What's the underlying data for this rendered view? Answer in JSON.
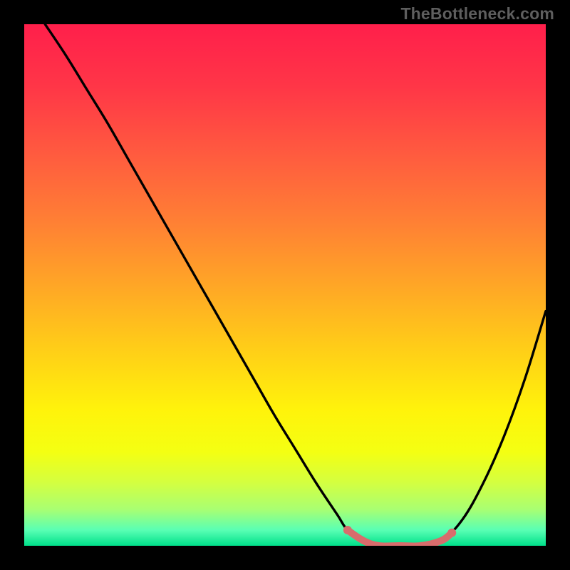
{
  "watermark": "TheBottleneck.com",
  "chart_data": {
    "type": "line",
    "title": "",
    "xlabel": "",
    "ylabel": "",
    "xlim": [
      0,
      100
    ],
    "ylim": [
      0,
      100
    ],
    "grid": false,
    "legend": false,
    "gradient_stops": [
      {
        "offset": 0.0,
        "color": "#ff1f4b"
      },
      {
        "offset": 0.12,
        "color": "#ff3647"
      },
      {
        "offset": 0.25,
        "color": "#ff5b3f"
      },
      {
        "offset": 0.38,
        "color": "#ff8034"
      },
      {
        "offset": 0.5,
        "color": "#ffa626"
      },
      {
        "offset": 0.62,
        "color": "#ffcd18"
      },
      {
        "offset": 0.74,
        "color": "#fff30b"
      },
      {
        "offset": 0.82,
        "color": "#f4ff12"
      },
      {
        "offset": 0.88,
        "color": "#d3ff41"
      },
      {
        "offset": 0.93,
        "color": "#a9ff72"
      },
      {
        "offset": 0.97,
        "color": "#59ffb4"
      },
      {
        "offset": 1.0,
        "color": "#00e08a"
      }
    ],
    "series": [
      {
        "name": "bottleneck-curve",
        "type": "line",
        "x": [
          4,
          8,
          12,
          16,
          20,
          24,
          28,
          32,
          36,
          40,
          44,
          48,
          52,
          56,
          60,
          62,
          65,
          68,
          72,
          76,
          80,
          84,
          88,
          92,
          96,
          100
        ],
        "y": [
          100,
          94,
          87.5,
          81,
          74,
          67,
          60,
          53,
          46,
          39,
          32,
          25,
          18.5,
          12,
          6,
          3,
          1,
          0,
          0,
          0,
          1,
          5,
          12,
          21,
          32,
          45
        ]
      },
      {
        "name": "optimal-range",
        "type": "line",
        "x": [
          62,
          65,
          68,
          72,
          76,
          80,
          82
        ],
        "y": [
          3,
          1,
          0,
          0,
          0,
          1,
          2.5
        ]
      }
    ],
    "sweet_spot": {
      "x_start": 62,
      "x_end": 82
    },
    "colors": {
      "curve": "#000000",
      "highlight": "#d86c6c",
      "background": "#000000"
    }
  }
}
